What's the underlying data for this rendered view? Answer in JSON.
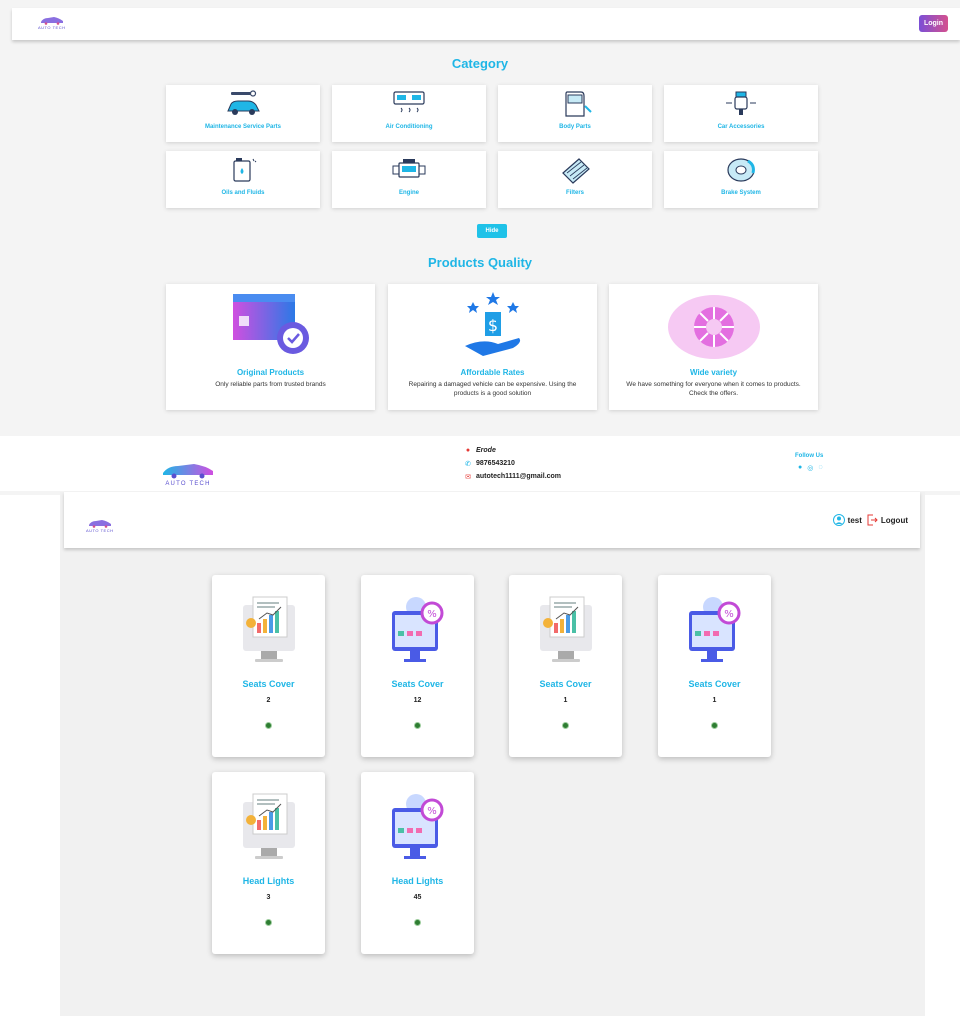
{
  "top_page": {
    "nav": {
      "logo_text": "AUTO TECH",
      "login_label": "Login"
    },
    "category_title": "Category",
    "categories": [
      {
        "label": "Maintenance Service Parts",
        "icon": "car-tools-icon"
      },
      {
        "label": "Air Conditioning",
        "icon": "air-conditioner-icon"
      },
      {
        "label": "Body Parts",
        "icon": "car-door-icon"
      },
      {
        "label": "Car Accessories",
        "icon": "car-charger-icon"
      },
      {
        "label": "Oils and Fluids",
        "icon": "oil-can-icon"
      },
      {
        "label": "Engine",
        "icon": "engine-icon"
      },
      {
        "label": "Filters",
        "icon": "air-filter-icon"
      },
      {
        "label": "Brake System",
        "icon": "brake-disc-icon"
      }
    ],
    "hide_label": "Hide",
    "quality_title": "Products Quality",
    "quality": [
      {
        "title": "Original Products",
        "desc": "Only reliable parts from trusted brands",
        "icon": "box-badge-icon"
      },
      {
        "title": "Affordable Rates",
        "desc": "Repairing a damaged vehicle can be expensive. Using the products is a good solution",
        "icon": "price-tag-hand-icon"
      },
      {
        "title": "Wide variety",
        "desc": "We have something for everyone when it comes to products. Check the offers.",
        "icon": "donut-icon"
      }
    ],
    "footer": {
      "logo_text": "AUTO TECH",
      "location": "Erode",
      "phone": "9876543210",
      "email": "autotech1111@gmail.com",
      "follow_label": "Follow Us"
    }
  },
  "second_page": {
    "nav": {
      "logo_text": "AUTO TECH",
      "user": "test",
      "logout_label": "Logout"
    },
    "products": [
      {
        "name": "Seats Cover",
        "qty": "2",
        "image": "report-chart-icon"
      },
      {
        "name": "Seats Cover",
        "qty": "12",
        "image": "monitor-discount-icon"
      },
      {
        "name": "Seats Cover",
        "qty": "1",
        "image": "report-chart-icon"
      },
      {
        "name": "Seats Cover",
        "qty": "1",
        "image": "monitor-discount-icon"
      },
      {
        "name": "Head Lights",
        "qty": "3",
        "image": "report-chart-icon"
      },
      {
        "name": "Head Lights",
        "qty": "45",
        "image": "monitor-discount-icon"
      }
    ]
  },
  "colors": {
    "accent": "#1fb6e6",
    "brand_purple": "#7b4fd6",
    "brand_pink": "#d4508e",
    "status_green": "#2e7d32"
  }
}
